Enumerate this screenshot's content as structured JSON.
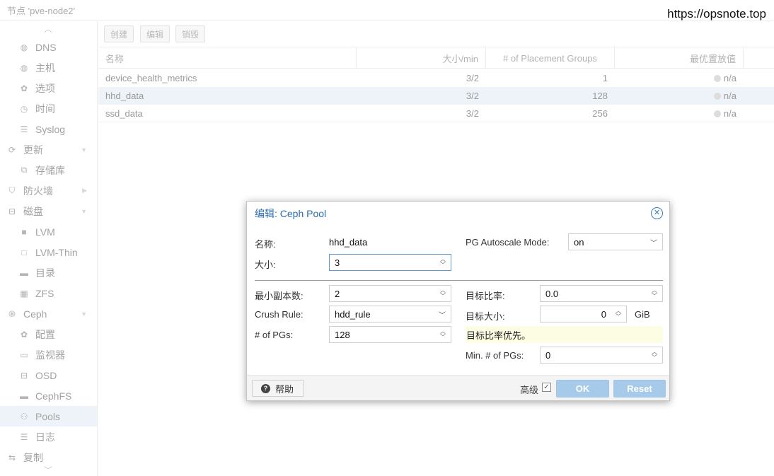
{
  "header": {
    "node_title": "节点 'pve-node2'"
  },
  "watermark": "https://opsnote.top",
  "sidebar": {
    "items": [
      {
        "label": "DNS",
        "icon": "globe-icon",
        "glyph": "◍"
      },
      {
        "label": "主机",
        "icon": "globe-icon",
        "glyph": "◍"
      },
      {
        "label": "选项",
        "icon": "gear-icon",
        "glyph": "✿"
      },
      {
        "label": "时间",
        "icon": "clock-icon",
        "glyph": "◷"
      },
      {
        "label": "Syslog",
        "icon": "list-icon",
        "glyph": "☰"
      },
      {
        "label": "更新",
        "icon": "refresh-icon",
        "glyph": "⟳"
      },
      {
        "label": "存储库",
        "icon": "copy-icon",
        "glyph": "⧉"
      },
      {
        "label": "防火墙",
        "icon": "shield-icon",
        "glyph": "⛉"
      },
      {
        "label": "磁盘",
        "icon": "hdd-icon",
        "glyph": "⊟"
      },
      {
        "label": "LVM",
        "icon": "square-icon",
        "glyph": "■"
      },
      {
        "label": "LVM-Thin",
        "icon": "square-outline-icon",
        "glyph": "□"
      },
      {
        "label": "目录",
        "icon": "folder-icon",
        "glyph": "▬"
      },
      {
        "label": "ZFS",
        "icon": "grid-icon",
        "glyph": "▦"
      },
      {
        "label": "Ceph",
        "icon": "ceph-icon",
        "glyph": "֍"
      },
      {
        "label": "配置",
        "icon": "gear-icon",
        "glyph": "✿"
      },
      {
        "label": "监视器",
        "icon": "monitor-icon",
        "glyph": "▭"
      },
      {
        "label": "OSD",
        "icon": "hdd-icon",
        "glyph": "⊟"
      },
      {
        "label": "CephFS",
        "icon": "folder-icon",
        "glyph": "▬"
      },
      {
        "label": "Pools",
        "icon": "sitemap-icon",
        "glyph": "⚇"
      },
      {
        "label": "日志",
        "icon": "list-icon",
        "glyph": "☰"
      },
      {
        "label": "复制",
        "icon": "retweet-icon",
        "glyph": "⇆"
      }
    ]
  },
  "toolbar": {
    "create": "创建",
    "edit": "编辑",
    "destroy": "销毁"
  },
  "grid": {
    "columns": [
      "名称",
      "大小/min",
      "# of Placement Groups",
      "最优置放值"
    ],
    "rows": [
      {
        "name": "device_health_metrics",
        "size": "3/2",
        "pgs": "1",
        "optimal": "n/a"
      },
      {
        "name": "hhd_data",
        "size": "3/2",
        "pgs": "128",
        "optimal": "n/a"
      },
      {
        "name": "ssd_data",
        "size": "3/2",
        "pgs": "256",
        "optimal": "n/a"
      }
    ]
  },
  "modal": {
    "title": "编辑: Ceph Pool",
    "name_label": "名称:",
    "name_value": "hhd_data",
    "size_label": "大小:",
    "size_value": "3",
    "autoscale_label": "PG Autoscale Mode:",
    "autoscale_value": "on",
    "min_size_label": "最小副本数:",
    "min_size_value": "2",
    "crush_label": "Crush Rule:",
    "crush_value": "hdd_rule",
    "pgs_label": "# of PGs:",
    "pgs_value": "128",
    "target_ratio_label": "目标比率:",
    "target_ratio_value": "0.0",
    "target_size_label": "目标大小:",
    "target_size_value": "0",
    "target_size_unit": "GiB",
    "hint": "目标比率优先。",
    "min_pgs_label": "Min. # of PGs:",
    "min_pgs_value": "0",
    "help": "帮助",
    "advanced": "高级",
    "ok": "OK",
    "reset": "Reset"
  }
}
